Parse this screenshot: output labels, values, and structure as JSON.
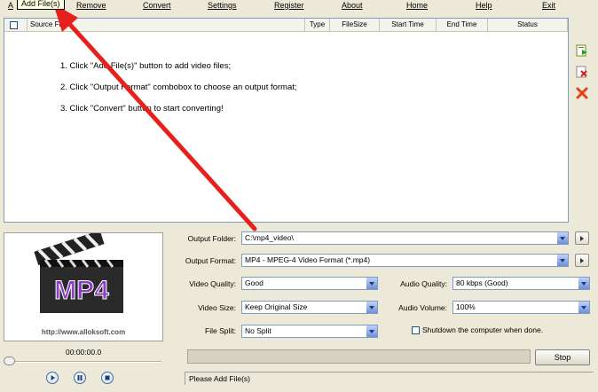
{
  "menu": {
    "items": [
      "Add File(s)",
      "Remove",
      "Convert",
      "Settings",
      "Register",
      "About",
      "Home",
      "Help",
      "Exit"
    ],
    "add_visible_fragment": "A"
  },
  "tooltip": "Add File(s)",
  "file_list": {
    "columns": [
      "Source File",
      "Type",
      "FileSize",
      "Start Time",
      "End Time",
      "Status"
    ],
    "instructions": [
      "1. Click \"Add File(s)\" button to add video files;",
      "2. Click \"Output Format\" combobox to choose an output format;",
      "3. Click \"Convert\" button to start converting!"
    ]
  },
  "side_icons": [
    "add-file-icon",
    "remove-file-icon",
    "clear-list-icon"
  ],
  "preview": {
    "logo_text": "MP4",
    "url": "http://www.alloksoft.com",
    "time": "00:00:00.0"
  },
  "settings": {
    "output_folder": {
      "label": "Output Folder:",
      "value": "C:\\mp4_video\\"
    },
    "output_format": {
      "label": "Output Format:",
      "value": "MP4 - MPEG-4 Video Format (*.mp4)"
    },
    "video_quality": {
      "label": "Video Quality:",
      "value": "Good"
    },
    "audio_quality": {
      "label": "Audio Quality:",
      "value": "80  kbps (Good)"
    },
    "video_size": {
      "label": "Video Size:",
      "value": "Keep Original Size"
    },
    "audio_volume": {
      "label": "Audio Volume:",
      "value": "100%"
    },
    "file_split": {
      "label": "File Split:",
      "value": "No Split"
    },
    "shutdown": {
      "label": "Shutdown the computer when done.",
      "checked": false
    }
  },
  "progress": 0,
  "stop_label": "Stop",
  "status": "Please Add File(s)",
  "colors": {
    "window": "#ece9d8",
    "annotation_arrow": "#e8201b",
    "mp4_logo": "#8a3fc4"
  }
}
